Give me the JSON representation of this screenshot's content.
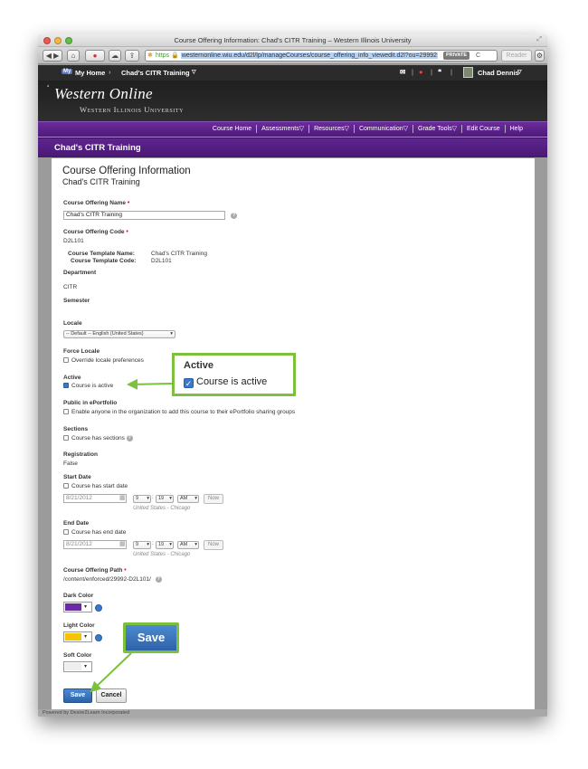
{
  "window": {
    "title": "Course Offering Information: Chad's CITR Training – Western Illinois University",
    "url_protocol": "https",
    "url": "westernonline.wiu.edu/d2l/lp/manageCourses/course_offering_info_viewedit.d2l?ou=29992",
    "private_badge": "PRIVATE",
    "reader_label": "Reader"
  },
  "minibar": {
    "home_badge": "My",
    "my_home": "My Home",
    "course_selector": "Chad's CITR Training",
    "user_name": "Chad Dennis"
  },
  "banner": {
    "title": "Western Online",
    "subtitle": "Western Illinois University"
  },
  "nav": {
    "items": [
      "Course Home",
      "Assessments",
      "Resources",
      "Communication",
      "Grade Tools",
      "Edit Course",
      "Help"
    ]
  },
  "course_bar": {
    "title": "Chad's CITR Training"
  },
  "page": {
    "heading": "Course Offering Information",
    "subheading": "Chad's CITR Training"
  },
  "form": {
    "name_label": "Course Offering Name",
    "name_value": "Chad's CITR Training",
    "code_label": "Course Offering Code",
    "code_value": "D2L101",
    "template_name_label": "Course Template Name:",
    "template_name_value": "Chad's CITR Training",
    "template_code_label": "Course Template Code:",
    "template_code_value": "D2L101",
    "department_label": "Department",
    "department_value": "CITR",
    "semester_label": "Semester",
    "locale_label": "Locale",
    "locale_value": "-- Default -- English (United States)",
    "force_locale_label": "Force Locale",
    "force_locale_option": "Override locale preferences",
    "active_label": "Active",
    "active_option": "Course is active",
    "active_checked": true,
    "eportfolio_label": "Public in ePortfolio",
    "eportfolio_option": "Enable anyone in the organization to add this course to their ePortfolio sharing groups",
    "sections_label": "Sections",
    "sections_option": "Course has sections",
    "registration_label": "Registration",
    "registration_value": "False",
    "start_label": "Start Date",
    "start_option": "Course has start date",
    "start_date": "8/21/2012",
    "start_hour": "9",
    "start_minute": "19",
    "start_ampm": "AM",
    "end_label": "End Date",
    "end_option": "Course has end date",
    "end_date": "8/21/2012",
    "end_hour": "9",
    "end_minute": "19",
    "end_ampm": "AM",
    "now_label": "Now",
    "timezone": "United States - Chicago",
    "path_label": "Course Offering Path",
    "path_value": "/content/enforced/29992-D2L101/",
    "dark_label": "Dark Color",
    "dark_color": "#6a2ca0",
    "light_label": "Light Color",
    "light_color": "#f5c400",
    "soft_label": "Soft Color",
    "soft_color": "#eeeeee",
    "save_label": "Save",
    "cancel_label": "Cancel"
  },
  "callouts": {
    "active_title": "Active",
    "active_text": "Course is active",
    "save_text": "Save"
  },
  "footer": "Powered by Desire2Learn Incorporated",
  "colors": {
    "purple_nav": "#5d2590",
    "callout_green": "#7cc13b",
    "button_blue": "#2d62a8"
  }
}
